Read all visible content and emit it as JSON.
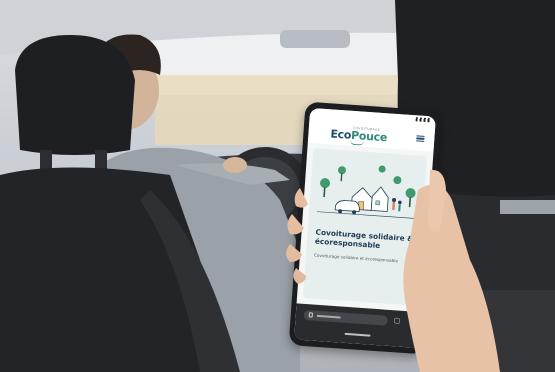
{
  "scene": {
    "description_tags": [
      "car-interior",
      "driver",
      "passenger-hand",
      "smartphone"
    ]
  },
  "phone": {
    "site": {
      "logo_small": "COVOITURAGE",
      "logo_text_1": "Eco",
      "logo_text_2": "Pouce",
      "hero_title": "Covoiturage solidaire & écoresponsable",
      "hero_subtitle": "Covoiturage solidaire et écoresponsable"
    },
    "icons": {
      "menu": "menu-icon",
      "lock": "lock-icon",
      "tabs": "tabs-icon",
      "more": "more-icon"
    }
  }
}
